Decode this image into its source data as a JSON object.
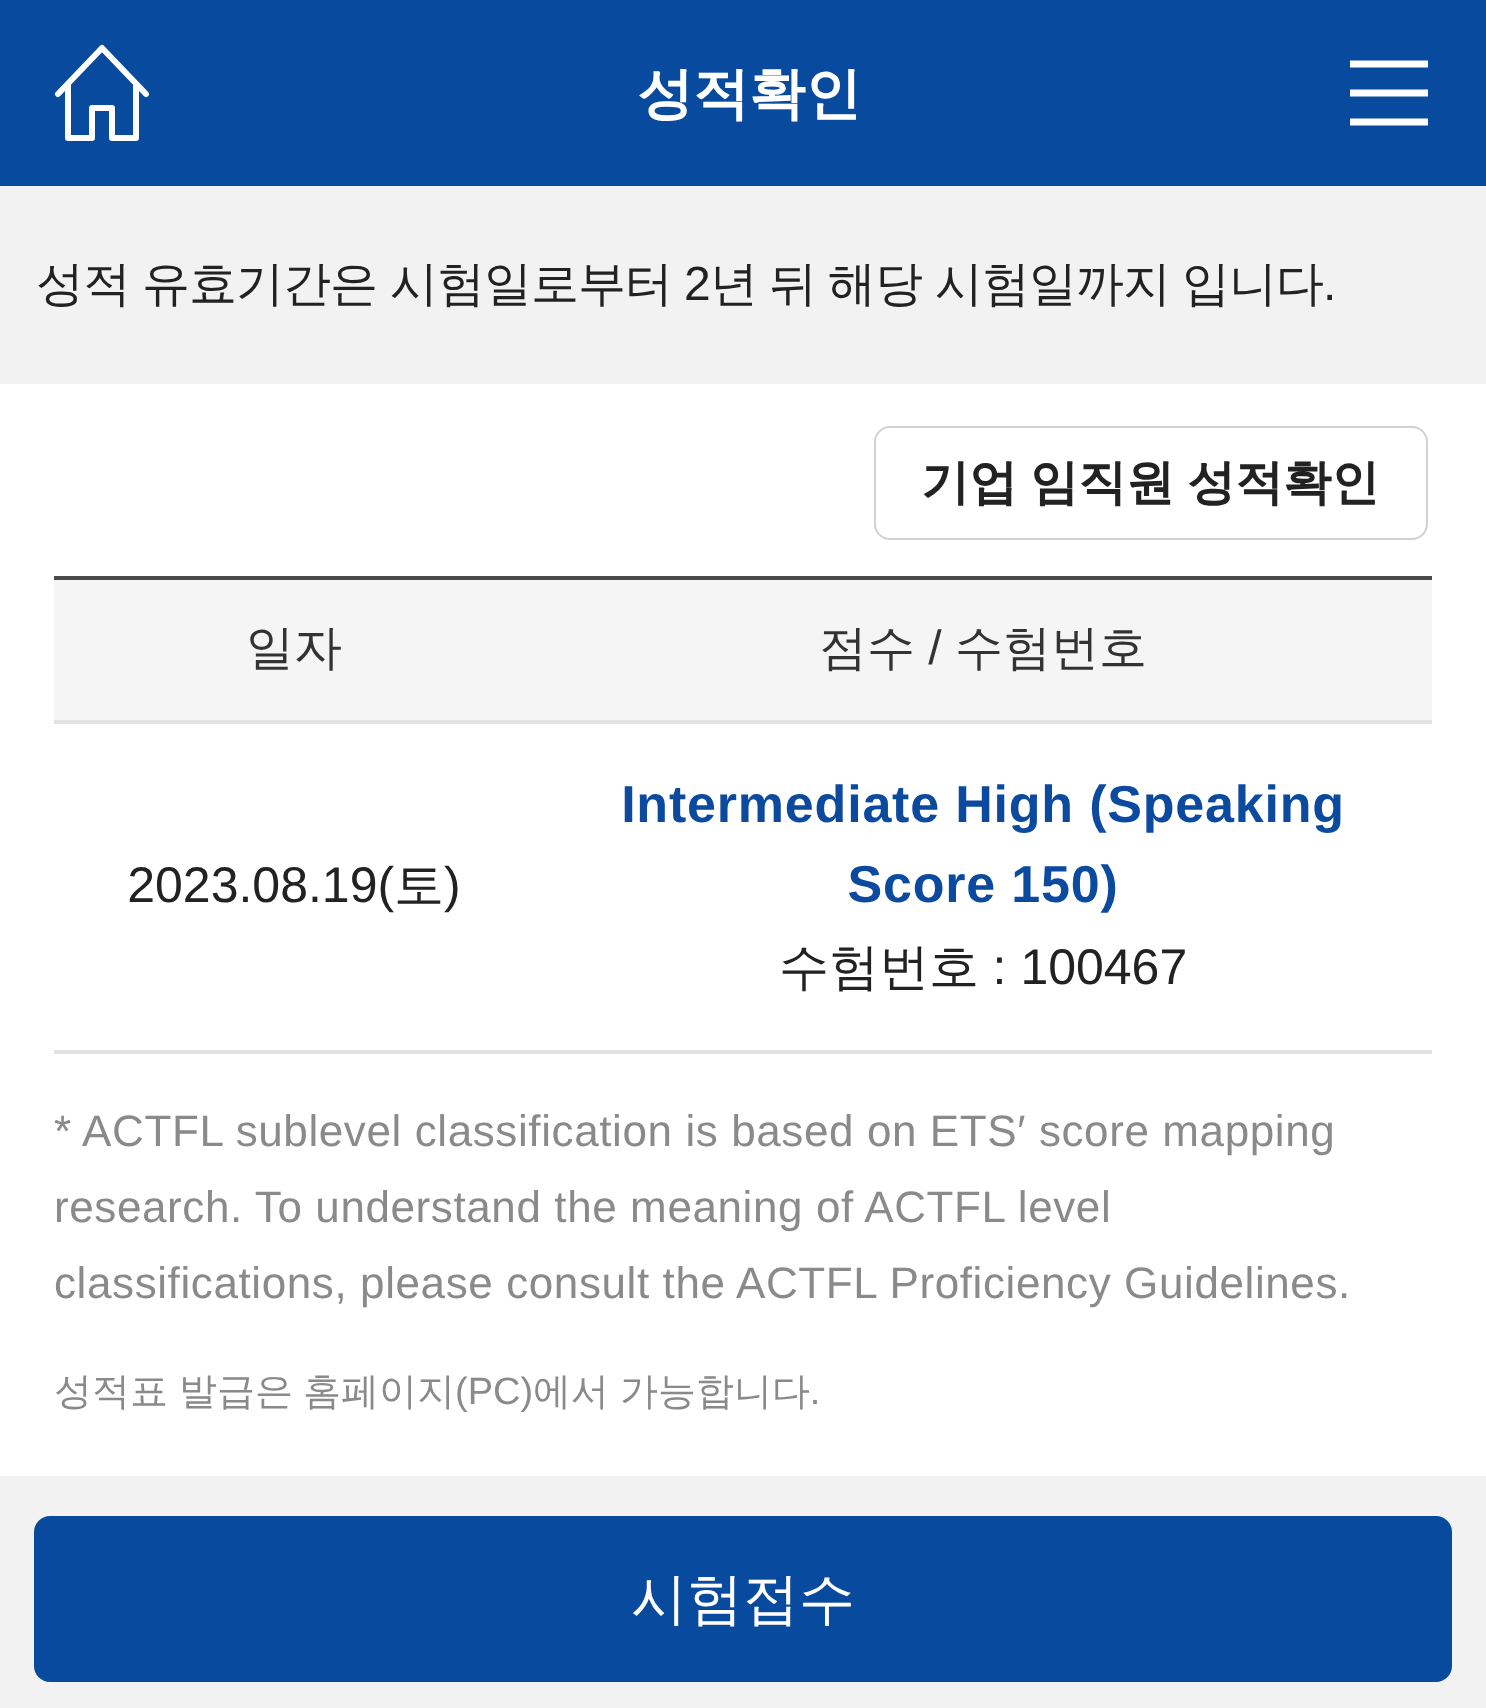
{
  "header": {
    "title": "성적확인"
  },
  "notice": "성적 유효기간은 시험일로부터 2년 뒤 해당 시험일까지 입니다.",
  "corporate_button": "기업 임직원 성적확인",
  "table": {
    "columns": [
      "일자",
      "점수 / 수험번호"
    ],
    "rows": [
      {
        "date": "2023.08.19(토)",
        "score": "Intermediate High (Speaking Score 150)",
        "exam_number": "수험번호 : 100467"
      }
    ]
  },
  "notes": [
    "* ACTFL sublevel classification is based on ETS′ score mapping research. To understand the meaning of ACTFL level classifications, please consult the ACTFL Proficiency Guidelines.",
    "성적표 발급은 홈페이지(PC)에서 가능합니다."
  ],
  "footer_button": "시험접수"
}
